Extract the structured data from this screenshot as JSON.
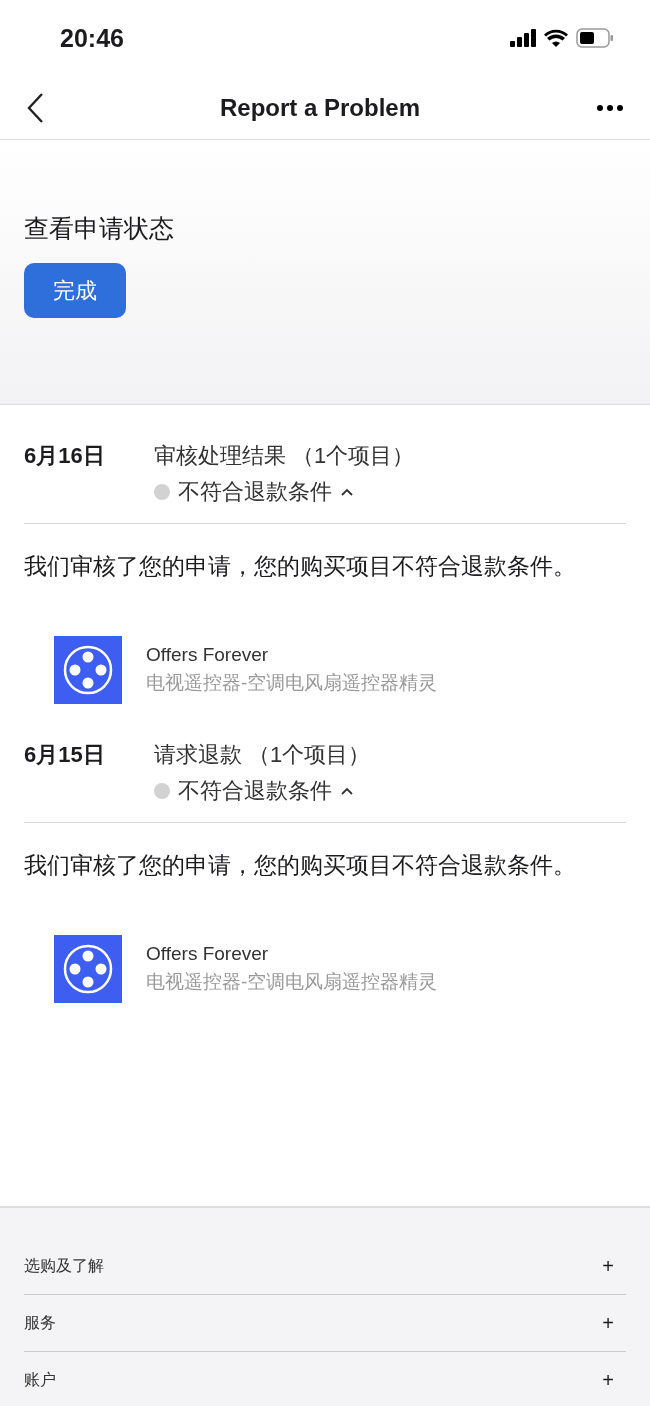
{
  "status_bar": {
    "time": "20:46"
  },
  "nav": {
    "title": "Report a Problem"
  },
  "header": {
    "title": "查看申请状态",
    "button": "完成"
  },
  "entries": [
    {
      "date": "6月16日",
      "title": "审核处理结果 （1个项目）",
      "status": "不符合退款条件",
      "expanded": true,
      "message": "我们审核了您的申请，您的购买项目不符合退款条件。",
      "product": {
        "developer": "Offers Forever",
        "name": "电视遥控器-空调电风扇遥控器精灵"
      }
    },
    {
      "date": "6月15日",
      "title": "请求退款 （1个项目）",
      "status": "不符合退款条件",
      "expanded": true,
      "message": "我们审核了您的申请，您的购买项目不符合退款条件。",
      "product": {
        "developer": "Offers Forever",
        "name": "电视遥控器-空调电风扇遥控器精灵"
      }
    }
  ],
  "footer": [
    {
      "label": "选购及了解",
      "sign": "+"
    },
    {
      "label": "服务",
      "sign": "+"
    },
    {
      "label": "账户",
      "sign": "+"
    }
  ]
}
